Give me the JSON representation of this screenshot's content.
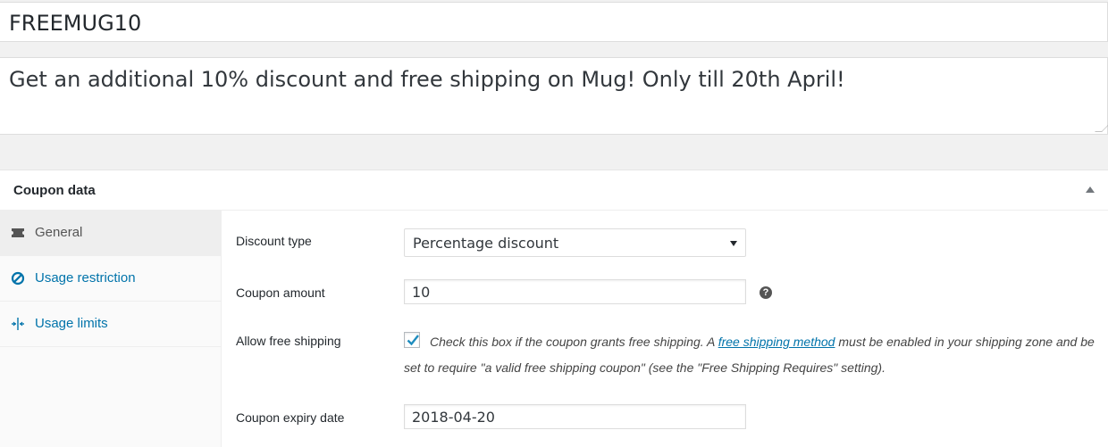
{
  "coupon": {
    "code": "FREEMUG10",
    "description": "Get an additional 10% discount and free shipping on Mug! Only till 20th April!"
  },
  "panel": {
    "title": "Coupon data",
    "tabs": [
      {
        "label": "General",
        "icon": "ticket-icon",
        "active": true
      },
      {
        "label": "Usage restriction",
        "icon": "restriction-icon",
        "active": false
      },
      {
        "label": "Usage limits",
        "icon": "limits-icon",
        "active": false
      }
    ]
  },
  "fields": {
    "discount_type": {
      "label": "Discount type",
      "value": "Percentage discount"
    },
    "coupon_amount": {
      "label": "Coupon amount",
      "value": "10"
    },
    "free_shipping": {
      "label": "Allow free shipping",
      "checked": true,
      "desc_before": "Check this box if the coupon grants free shipping. A ",
      "desc_link": "free shipping method",
      "desc_after": " must be enabled in your shipping zone and be set to require \"a valid free shipping coupon\" (see the \"Free Shipping Requires\" setting)."
    },
    "expiry_date": {
      "label": "Coupon expiry date",
      "value": "2018-04-20"
    }
  },
  "colors": {
    "link": "#0073aa",
    "check": "#1e8cbe"
  }
}
